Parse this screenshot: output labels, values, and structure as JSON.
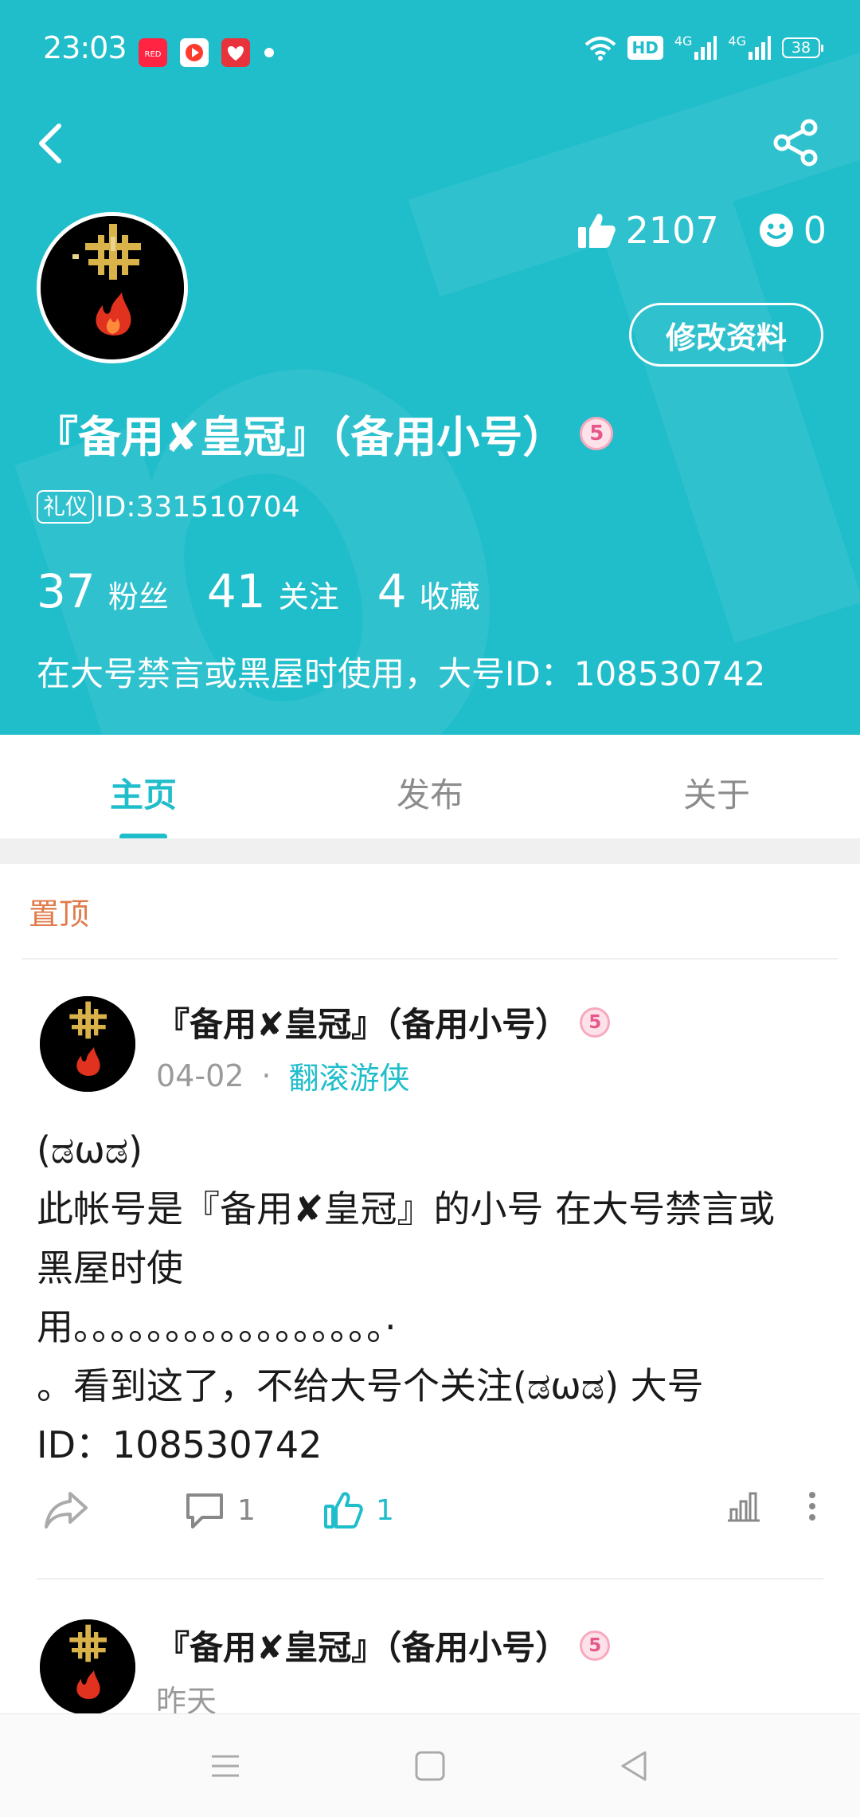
{
  "status_bar": {
    "time": "23:03",
    "app_badges": [
      "xiaohongshu-icon",
      "video-player-icon",
      "heart-app-icon"
    ],
    "hd_label": "HD",
    "network_1": "4G",
    "network_2": "4G",
    "battery": "38"
  },
  "header": {
    "back_icon": "back-chevron-icon",
    "share_icon": "share-icon",
    "likes_count": "2107",
    "smiles_count": "0",
    "edit_button": "修改资料",
    "display_name": "『备用✘皇冠』（备用小号）",
    "level_badge": "5",
    "id_tag": "礼仪",
    "id_text": "ID:331510704",
    "followers_count": "37",
    "followers_label": "粉丝",
    "following_count": "41",
    "following_label": "关注",
    "favorites_count": "4",
    "favorites_label": "收藏",
    "bio": "在大号禁言或黑屋时使用，大号ID：108530742"
  },
  "tabs": [
    {
      "label": "主页",
      "active": true
    },
    {
      "label": "发布",
      "active": false
    },
    {
      "label": "关于",
      "active": false
    }
  ],
  "feed": {
    "pinned_label": "置顶",
    "post1": {
      "author": "『备用✘皇冠』（备用小号）",
      "level": "5",
      "date": "04-02",
      "separator": "·",
      "category": "翻滚游侠",
      "body": "(ಡωಡ)\n此帐号是『备用✘皇冠』的小号 在大号禁言或\n黑屋时使\n用。。。。。。。。。。。。。。。。。·\n。看到这了，不给大号个关注(ಡωಡ) 大号\nID：108530742",
      "comments": "1",
      "likes": "1"
    },
    "post2": {
      "author": "『备用✘皇冠』（备用小号）",
      "level": "5",
      "date": "昨天"
    }
  },
  "colors": {
    "accent": "#20bdcb",
    "pinned": "#e07a4a",
    "badge_pink": "#e6588a"
  }
}
